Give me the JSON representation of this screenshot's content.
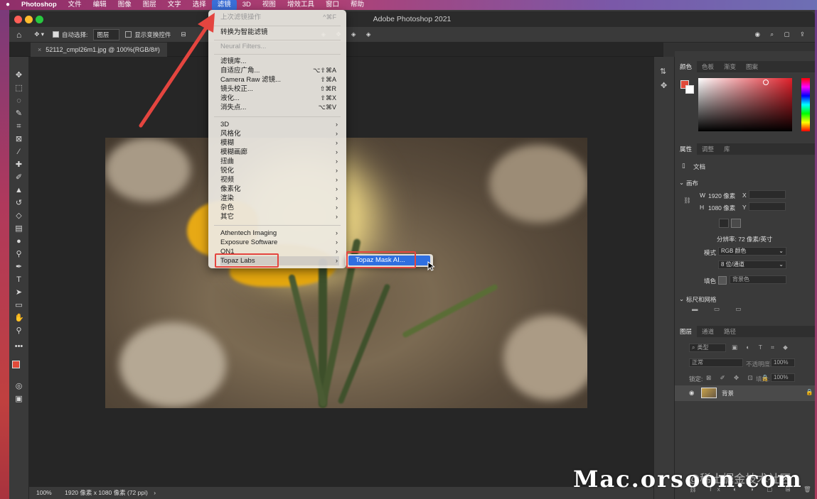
{
  "menubar": {
    "apple": "",
    "app_name": "Photoshop",
    "items": [
      "文件",
      "编辑",
      "图像",
      "图层",
      "文字",
      "选择",
      "滤镜",
      "3D",
      "视图",
      "增效工具",
      "窗口",
      "帮助"
    ],
    "active": "滤镜"
  },
  "window": {
    "title": "Adobe Photoshop 2021"
  },
  "options": {
    "auto_select_label": "自动选择:",
    "auto_select_value": "图层",
    "show_transform_label": "显示变换控件"
  },
  "document": {
    "tab_label": "52112_cmpl26m1.jpg @ 100%(RGB/8#)"
  },
  "status": {
    "zoom": "100%",
    "info": "1920 像素 x 1080 像素 (72 ppi)",
    "arrow": "›"
  },
  "filter_menu": {
    "last_filter": {
      "label": "上次滤镜操作",
      "shortcut": "^⌘F"
    },
    "smart_filter": "转换为智能滤镜",
    "neural": "Neural Filters...",
    "group1": [
      {
        "label": "滤镜库...",
        "shortcut": ""
      },
      {
        "label": "自适应广角...",
        "shortcut": "⌥⇧⌘A"
      },
      {
        "label": "Camera Raw 滤镜...",
        "shortcut": "⇧⌘A"
      },
      {
        "label": "镜头校正...",
        "shortcut": "⇧⌘R"
      },
      {
        "label": "液化...",
        "shortcut": "⇧⌘X"
      },
      {
        "label": "消失点...",
        "shortcut": "⌥⌘V"
      }
    ],
    "group2": [
      "3D",
      "风格化",
      "模糊",
      "模糊画廊",
      "扭曲",
      "锐化",
      "视频",
      "像素化",
      "渲染",
      "杂色",
      "其它"
    ],
    "group3": [
      "Athentech Imaging",
      "Exposure Software",
      "ON1",
      "Topaz Labs"
    ],
    "submenu_arrow": "›",
    "submenu_item": "Topaz Mask AI..."
  },
  "panels": {
    "color_tabs": [
      "颜色",
      "色板",
      "渐变",
      "图案"
    ],
    "props_tabs": [
      "属性",
      "调整",
      "库"
    ],
    "doc_label": "文档",
    "canvas_section": "画布",
    "width_label": "W",
    "width_value": "1920 像素",
    "x_label": "X",
    "height_label": "H",
    "height_value": "1080 像素",
    "y_label": "Y",
    "resolution": "分辨率: 72 像素/英寸",
    "mode_label": "模式",
    "mode_value": "RGB 颜色",
    "depth_value": "8 位/通道",
    "fill_label": "填色",
    "fill_value": "背景色",
    "rulers_section": "标尺和网格",
    "layers_tabs": [
      "图层",
      "通道",
      "路径"
    ],
    "layer_filter": "类型",
    "blend_mode": "正常",
    "opacity_label": "不透明度:",
    "opacity_value": "100%",
    "lock_label": "锁定:",
    "fill_pct_label": "填充:",
    "fill_pct_value": "100%",
    "layer_name": "背景"
  },
  "watermark": {
    "main": "Mac.orsoon.com",
    "secondary": "@稀土掘金技术社区"
  },
  "colors": {
    "highlight": "#e4453f",
    "selection": "#2f6fe0",
    "foreground": "#e04a3a"
  }
}
